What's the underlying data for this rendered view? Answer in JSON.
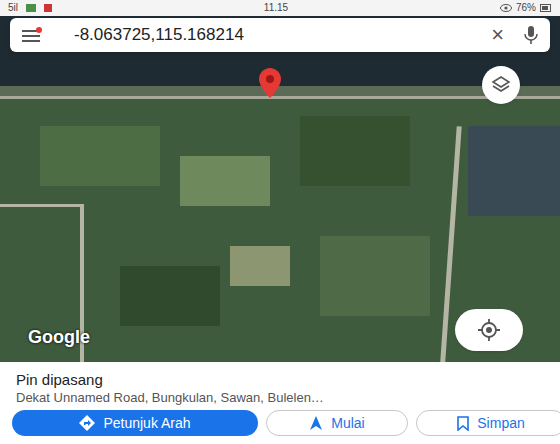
{
  "status_bar": {
    "signal": "5il",
    "time": "11.15",
    "battery": "76%"
  },
  "search": {
    "value": "-8.063725,115.168214",
    "clear": "×"
  },
  "map": {
    "logo": "Google"
  },
  "place": {
    "title": "Pin dipasang",
    "address": "Dekat Unnamed Road, Bungkulan, Sawan, Bulelen…"
  },
  "actions": [
    {
      "label": "Petunjuk Arah",
      "kind": "primary"
    },
    {
      "label": "Mulai",
      "kind": "outline"
    },
    {
      "label": "Simpan",
      "kind": "outline"
    }
  ]
}
